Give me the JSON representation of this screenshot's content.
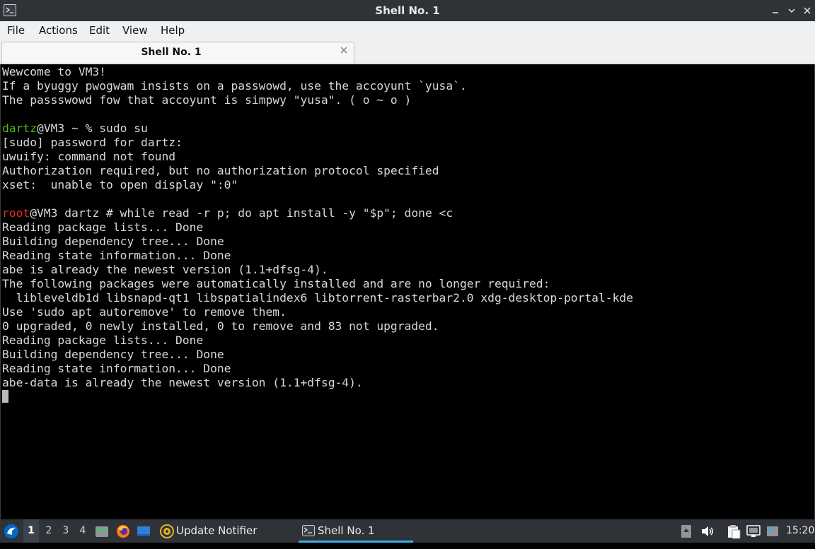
{
  "window": {
    "title": "Shell No. 1",
    "controls": {
      "minimize": "_",
      "restore": "▴",
      "maximize": "▵",
      "close": "✕"
    }
  },
  "menu": [
    "File",
    "Actions",
    "Edit",
    "View",
    "Help"
  ],
  "tab": {
    "label": "Shell No. 1",
    "close": "✕"
  },
  "terminal": {
    "lines": [
      "Wewcome to VM3!",
      "If a byuggy pwogwam insists on a passwowd, use the accoyunt `yusa`.",
      "The passswowd fow that accoyunt is simpwy \"yusa\". ( o ~ o )",
      "",
      "%PROMPT1%",
      "[sudo] password for dartz:",
      "uwuify: command not found",
      "Authorization required, but no authorization protocol specified",
      "xset:  unable to open display \":0\"",
      "",
      "%PROMPT2%",
      "Reading package lists... Done",
      "Building dependency tree... Done",
      "Reading state information... Done",
      "abe is already the newest version (1.1+dfsg-4).",
      "The following packages were automatically installed and are no longer required:",
      "  libleveldb1d libsnapd-qt1 libspatialindex6 libtorrent-rasterbar2.0 xdg-desktop-portal-kde",
      "Use 'sudo apt autoremove' to remove them.",
      "0 upgraded, 0 newly installed, 0 to remove and 83 not upgraded.",
      "Reading package lists... Done",
      "Building dependency tree... Done",
      "Reading state information... Done",
      "abe-data is already the newest version (1.1+dfsg-4)."
    ],
    "prompt1": {
      "user": "dartz",
      "rest": "@VM3 ~ % sudo su"
    },
    "prompt2": {
      "user": "root",
      "rest": "@VM3 dartz # while read -r p; do apt install -y \"$p\"; done <c"
    },
    "colors": {
      "user_prompt": "#4cbb17",
      "root_prompt": "#e0302a",
      "text": "#d8d8d8",
      "background": "#000000"
    }
  },
  "taskbar": {
    "desktops": [
      "1",
      "2",
      "3",
      "4"
    ],
    "active_desktop": "1",
    "update_notifier": "Update Notifier",
    "shell_task": "Shell No. 1",
    "clock": "15:20",
    "accent": "#3daee9"
  }
}
